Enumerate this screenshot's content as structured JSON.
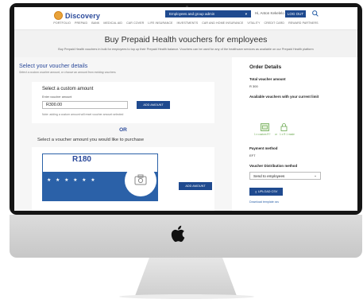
{
  "header": {
    "brand": "Discovery",
    "employer_menu_label": "Employees and group admin",
    "greeting": "Hi, Anton Kekelelo",
    "logout_label": "LOG OUT"
  },
  "nav": [
    "PORTFOLIO",
    "PREPAID",
    "BANK",
    "MEDICAL AID",
    "CAR COVER",
    "LIFE INSURANCE",
    "INVESTMENTS",
    "CAR AND HOME INSURANCE",
    "VITALITY",
    "CREDIT CARD",
    "REWARD PARTNERS"
  ],
  "page": {
    "title": "Buy Prepaid Health vouchers for employees",
    "subtitle": "Buy Prepaid Health vouchers in bulk for employees to top up their Prepaid Health balance. Vouchers can be used for any of the healthcare services as available on our Prepaid Health platform"
  },
  "voucher_details": {
    "title": "Select your voucher details",
    "subtitle": "Select a custom voucher amount, or choose an amount from existing vouchers",
    "custom": {
      "title": "Select a custom amount",
      "field_label": "Enter voucher amount",
      "value": "R300.00",
      "add_label": "ADD AMOUNT",
      "note": "Note: adding a custom amount will reset voucher amount selected"
    },
    "or_label": "OR",
    "existing_title": "Select a voucher amount you would like to purchase",
    "voucher": {
      "amount": "R180",
      "stars": "★ ★ ★ ★ ★ ★",
      "add_label": "ADD AMOUNT"
    }
  },
  "order": {
    "title": "Order Details",
    "total_label": "Total voucher amount",
    "total_value": "R 300",
    "available_label": "Available vouchers with your current limit",
    "option_a": "1 x custom R?",
    "option_or": "or",
    "option_b": "1 x R 1 made",
    "payment_label": "Payment method",
    "payment_value": "EFT",
    "distribution_label": "Voucher Distribution method",
    "distribution_value": "Send to employees",
    "upload_label": "UPLOAD CSV",
    "download_label": "Download template csv"
  },
  "colors": {
    "brand_blue": "#1f4a8f",
    "title_blue": "#2b4a9b",
    "accent_green": "#6aa84f",
    "logo_orange": "#e8a23a"
  }
}
